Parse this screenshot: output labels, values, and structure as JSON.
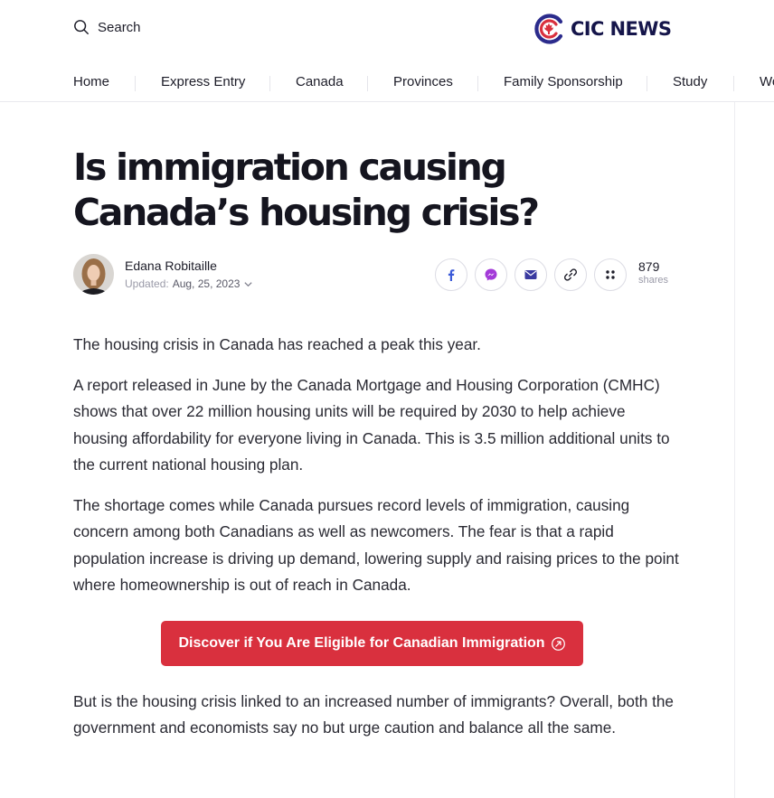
{
  "header": {
    "search_label": "Search",
    "logo_text": "CIC NEWS",
    "brand_color": "#d9303e",
    "brand_dark": "#15154a"
  },
  "nav": {
    "items": [
      {
        "label": "Home"
      },
      {
        "label": "Express Entry"
      },
      {
        "label": "Canada"
      },
      {
        "label": "Provinces"
      },
      {
        "label": "Family Sponsorship"
      },
      {
        "label": "Study"
      },
      {
        "label": "Wo"
      }
    ]
  },
  "article": {
    "title": "Is immigration causing Canada’s housing crisis?",
    "author": {
      "name": "Edana Robitaille",
      "updated_label": "Updated:",
      "date": "Aug, 25, 2023"
    },
    "share": {
      "buttons": [
        "facebook-icon",
        "messenger-icon",
        "email-icon",
        "link-icon",
        "more-icon"
      ],
      "count": "879",
      "count_label": "shares"
    },
    "paragraphs": [
      "The housing crisis in Canada has reached a peak this year.",
      "A report released in June by the Canada Mortgage and Housing Corporation (CMHC) shows that over 22 million housing units will be required by 2030 to help achieve housing affordability for everyone living in Canada. This is 3.5 million additional units to the current national housing plan.",
      "The shortage comes while Canada pursues record levels of immigration, causing concern among both Canadians as well as newcomers. The fear is that a rapid population increase is driving up demand, lowering supply and raising prices to the point where homeownership is out of reach in Canada.",
      "But is the housing crisis linked to an increased number of immigrants? Overall, both the government and economists say no but urge caution and balance all the same."
    ],
    "cta_label": "Discover if You Are Eligible for Canadian Immigration"
  }
}
